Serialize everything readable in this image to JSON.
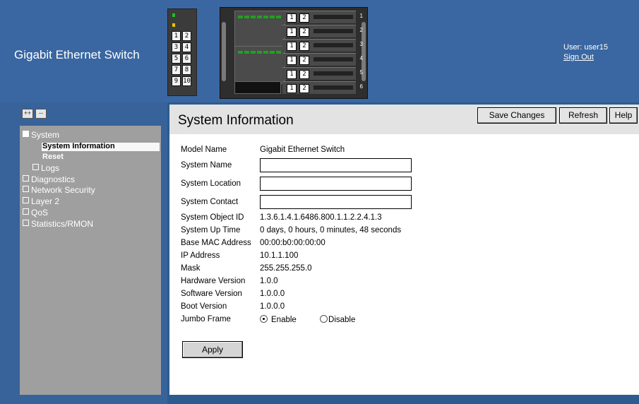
{
  "header": {
    "brand": "Gigabit Ethernet Switch",
    "user_label": "User: user15",
    "sign_out": "Sign Out",
    "stack_ports": [
      "1",
      "2",
      "3",
      "4",
      "5",
      "6",
      "7",
      "8",
      "9",
      "10"
    ],
    "chassis_slots": [
      "1",
      "2",
      "3",
      "4",
      "5",
      "6"
    ],
    "slot_buttons": [
      "1",
      "2"
    ]
  },
  "sidebar": {
    "expand_all": "++",
    "collapse_all": "--",
    "tree": {
      "system": "System",
      "system_information": "System Information",
      "reset": "Reset",
      "logs": "Logs",
      "diagnostics": "Diagnostics",
      "network_security": "Network Security",
      "layer2": "Layer 2",
      "qos": "QoS",
      "statistics": "Statistics/RMON"
    }
  },
  "main": {
    "title": "System Information",
    "buttons": {
      "save": "Save Changes",
      "refresh": "Refresh",
      "help": "Help"
    },
    "fields": {
      "model_name": {
        "label": "Model Name",
        "value": "Gigabit Ethernet Switch"
      },
      "system_name": {
        "label": "System Name",
        "value": ""
      },
      "system_location": {
        "label": "System Location",
        "value": ""
      },
      "system_contact": {
        "label": "System Contact",
        "value": ""
      },
      "object_id": {
        "label": "System Object ID",
        "value": "1.3.6.1.4.1.6486.800.1.1.2.2.4.1.3"
      },
      "up_time": {
        "label": "System Up Time",
        "value": "0 days, 0 hours, 0 minutes, 48 seconds"
      },
      "base_mac": {
        "label": "Base MAC Address",
        "value": "00:00:b0:00:00:00"
      },
      "ip_address": {
        "label": "IP Address",
        "value": "10.1.1.100"
      },
      "mask": {
        "label": "Mask",
        "value": "255.255.255.0"
      },
      "hw_version": {
        "label": "Hardware Version",
        "value": "1.0.0"
      },
      "sw_version": {
        "label": "Software Version",
        "value": "1.0.0.0"
      },
      "boot_version": {
        "label": "Boot Version",
        "value": "1.0.0.0"
      },
      "jumbo_frame": {
        "label": "Jumbo Frame",
        "enable": "Enable",
        "disable": "Disable",
        "selected": "Enable"
      }
    },
    "apply": "Apply"
  }
}
